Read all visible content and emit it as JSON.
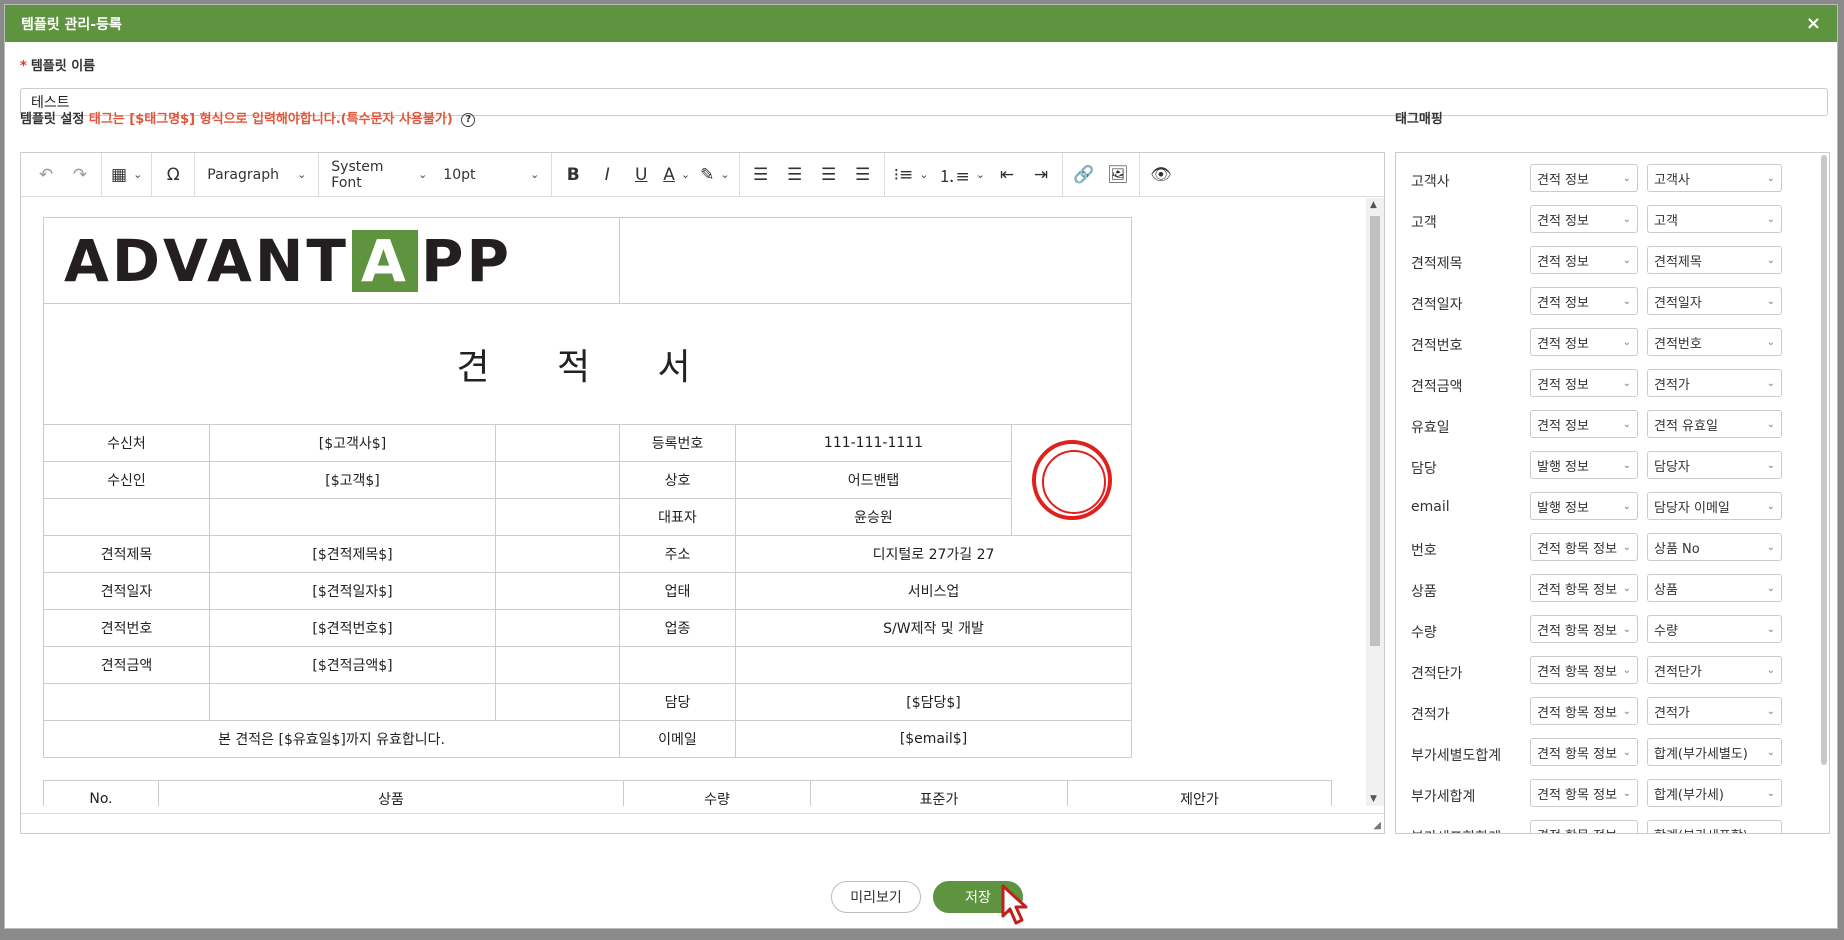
{
  "dialog": {
    "title": "템플릿 관리-등록",
    "close_label": "×"
  },
  "template_name": {
    "label": "템플릿 이름",
    "required_mark": "*",
    "value": "테스트"
  },
  "template_settings": {
    "label": "템플릿 설정",
    "warning": "태그는 [$태그명$] 형식으로 입력해야합니다.(특수문자 사용불가)",
    "help_icon": "question-circle-icon"
  },
  "toolbar": {
    "block_format": "Paragraph",
    "font_family": "System Font",
    "font_size": "10pt"
  },
  "document": {
    "logo_text_left": "ADVANT",
    "logo_text_mid": "A",
    "logo_text_right": "PP",
    "title": "견 적 서",
    "rows": [
      {
        "l_label": "수신처",
        "l_value": "[$고객사$]",
        "r_label": "등록번호",
        "r_value": "111-111-1111"
      },
      {
        "l_label": "수신인",
        "l_value": "[$고객$]",
        "r_label": "상호",
        "r_value": "어드밴탭"
      },
      {
        "l_label": "",
        "l_value": "",
        "r_label": "대표자",
        "r_value": "윤승원"
      },
      {
        "l_label": "견적제목",
        "l_value": "[$견적제목$]",
        "r_label": "주소",
        "r_value": "디지털로 27가길 27"
      },
      {
        "l_label": "견적일자",
        "l_value": "[$견적일자$]",
        "r_label": "업태",
        "r_value": "서비스업"
      },
      {
        "l_label": "견적번호",
        "l_value": "[$견적번호$]",
        "r_label": "업종",
        "r_value": "S/W제작 및 개발"
      },
      {
        "l_label": "견적금액",
        "l_value": "[$견적금액$]",
        "r_label": "",
        "r_value": ""
      },
      {
        "l_label": "",
        "l_value": "",
        "r_label": "담당",
        "r_value": "[$담당$]"
      }
    ],
    "validity_text": "본 견적은 [$유효일$]까지 유효합니다.",
    "email_label": "이메일",
    "email_value": "[$email$]",
    "items_header": [
      "No.",
      "상품",
      "수량",
      "표준가",
      "제안가"
    ]
  },
  "tag_mapping": {
    "label": "태그매핑",
    "rows": [
      {
        "name": "고객사",
        "category": "견적 정보",
        "field": "고객사"
      },
      {
        "name": "고객",
        "category": "견적 정보",
        "field": "고객"
      },
      {
        "name": "견적제목",
        "category": "견적 정보",
        "field": "견적제목"
      },
      {
        "name": "견적일자",
        "category": "견적 정보",
        "field": "견적일자"
      },
      {
        "name": "견적번호",
        "category": "견적 정보",
        "field": "견적번호"
      },
      {
        "name": "견적금액",
        "category": "견적 정보",
        "field": "견적가"
      },
      {
        "name": "유효일",
        "category": "견적 정보",
        "field": "견적 유효일"
      },
      {
        "name": "담당",
        "category": "발행 정보",
        "field": "담당자"
      },
      {
        "name": "email",
        "category": "발행 정보",
        "field": "담당자 이메일"
      },
      {
        "name": "번호",
        "category": "견적 항목 정보",
        "field": "상품 No"
      },
      {
        "name": "상품",
        "category": "견적 항목 정보",
        "field": "상품"
      },
      {
        "name": "수량",
        "category": "견적 항목 정보",
        "field": "수량"
      },
      {
        "name": "견적단가",
        "category": "견적 항목 정보",
        "field": "견적단가"
      },
      {
        "name": "견적가",
        "category": "견적 항목 정보",
        "field": "견적가"
      },
      {
        "name": "부가세별도합계",
        "category": "견적 항목 정보",
        "field": "합계(부가세별도)"
      },
      {
        "name": "부가세합계",
        "category": "견적 항목 정보",
        "field": "합계(부가세)"
      },
      {
        "name": "부가세포함합계",
        "category": "견적 항목 정보",
        "field": "합계(부가세포함)"
      }
    ]
  },
  "footer": {
    "preview_label": "미리보기",
    "save_label": "저장"
  },
  "colors": {
    "brand_green": "#5e9440",
    "warning": "#e2573b",
    "seal_red": "#e0201c"
  }
}
